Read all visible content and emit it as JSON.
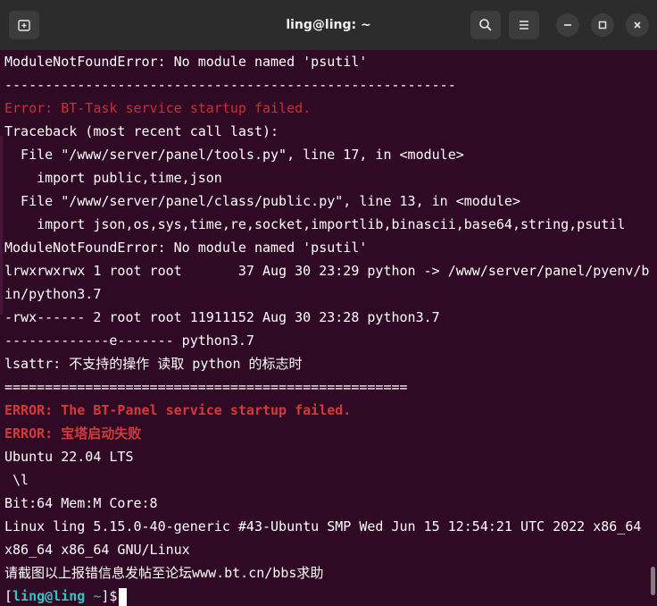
{
  "window": {
    "title": "ling@ling: ~"
  },
  "icons": {
    "new_tab": "new-tab-icon",
    "search": "search-icon",
    "menu": "hamburger-menu-icon",
    "minimize": "minimize-icon",
    "maximize": "maximize-icon",
    "close": "close-icon"
  },
  "colors": {
    "background": "#300a24",
    "error": "#cc2f2f",
    "prompt_path": "#2ec5c5"
  },
  "terminal": {
    "lines": [
      "ModuleNotFoundError: No module named 'psutil'",
      "--------------------------------------------------------",
      "Error: BT-Task service startup failed.",
      "Traceback (most recent call last):",
      "  File \"/www/server/panel/tools.py\", line 17, in <module>",
      "    import public,time,json",
      "  File \"/www/server/panel/class/public.py\", line 13, in <module>",
      "    import json,os,sys,time,re,socket,importlib,binascii,base64,string,psutil",
      "ModuleNotFoundError: No module named 'psutil'",
      "lrwxrwxrwx 1 root root       37 Aug 30 23:29 python -> /www/server/panel/pyenv/b",
      "in/python3.7",
      "-rwx------ 2 root root 11911152 Aug 30 23:28 python3.7",
      "-------------e------- python3.7",
      "lsattr: 不支持的操作 读取 python 的标志时",
      "==================================================",
      "ERROR: The BT-Panel service startup failed.",
      "ERROR: ",
      "宝塔启动失败",
      "Ubuntu 22.04 LTS",
      " \\l",
      "Bit:64 Mem:M Core:8",
      "Linux ling 5.15.0-40-generic #43-Ubuntu SMP Wed Jun 15 12:54:21 UTC 2022 x86_64",
      "x86_64 x86_64 GNU/Linux",
      "请截图以上报错信息发帖至论坛www.bt.cn/bbs求助"
    ],
    "prompt": {
      "open": "[",
      "user": "ling@ling",
      "path": "~",
      "close": "]$"
    }
  }
}
